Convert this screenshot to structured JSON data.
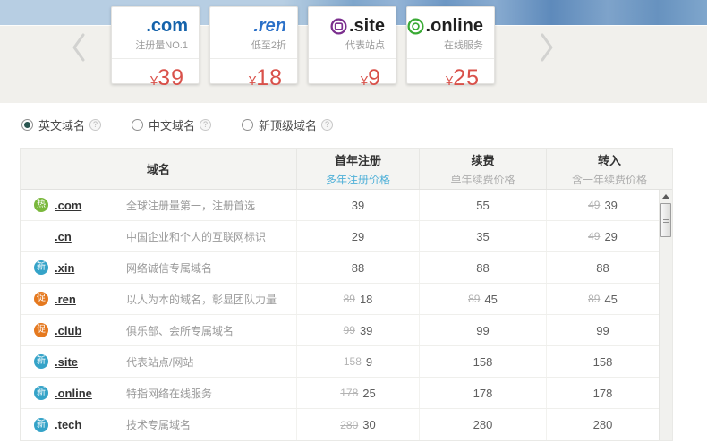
{
  "colors": {
    "accent_red": "#d9514a",
    "link_blue": "#4fb0d8",
    "com_blue": "#1563ab",
    "ren_blue": "#2a70c8",
    "badge_hot_green": "#7ab83c",
    "badge_new_blue": "#35a3c8",
    "badge_promo_orange": "#e5791f",
    "hero_band_blue": "#b7cee3"
  },
  "carousel": {
    "cards": [
      {
        "tld": ".com",
        "tagline": "注册量NO.1",
        "currency": "¥",
        "price": "39"
      },
      {
        "tld": ".ren",
        "tagline": "低至2折",
        "currency": "¥",
        "price": "18"
      },
      {
        "tld": ".site",
        "tagline": "代表站点",
        "currency": "¥",
        "price": "9"
      },
      {
        "tld": ".online",
        "tagline": "在线服务",
        "currency": "¥",
        "price": "25"
      }
    ]
  },
  "filters": {
    "help_icon": "?",
    "options": [
      {
        "label": "英文域名",
        "selected": true
      },
      {
        "label": "中文域名",
        "selected": false
      },
      {
        "label": "新顶级域名",
        "selected": false
      }
    ]
  },
  "table": {
    "headers": {
      "domain": "域名",
      "first_year": "首年注册",
      "first_year_sub": "多年注册价格",
      "renew": "续费",
      "renew_sub": "单年续费价格",
      "transfer": "转入",
      "transfer_sub": "含一年续费价格"
    },
    "rows": [
      {
        "badge": "热",
        "tld": ".com",
        "desc": "全球注册量第一，注册首选",
        "first_old": "",
        "first": "39",
        "renew_old": "",
        "renew": "55",
        "transfer_old": "49",
        "transfer": "39"
      },
      {
        "badge": "",
        "tld": ".cn",
        "desc": "中国企业和个人的互联网标识",
        "first_old": "",
        "first": "29",
        "renew_old": "",
        "renew": "35",
        "transfer_old": "49",
        "transfer": "29"
      },
      {
        "badge": "新",
        "tld": ".xin",
        "desc": "网络诚信专属域名",
        "first_old": "",
        "first": "88",
        "renew_old": "",
        "renew": "88",
        "transfer_old": "",
        "transfer": "88"
      },
      {
        "badge": "促",
        "tld": ".ren",
        "desc": "以人为本的域名，彰显团队力量",
        "first_old": "89",
        "first": "18",
        "renew_old": "89",
        "renew": "45",
        "transfer_old": "89",
        "transfer": "45"
      },
      {
        "badge": "促",
        "tld": ".club",
        "desc": "俱乐部、会所专属域名",
        "first_old": "99",
        "first": "39",
        "renew_old": "",
        "renew": "99",
        "transfer_old": "",
        "transfer": "99"
      },
      {
        "badge": "新",
        "tld": ".site",
        "desc": "代表站点/网站",
        "first_old": "158",
        "first": "9",
        "renew_old": "",
        "renew": "158",
        "transfer_old": "",
        "transfer": "158"
      },
      {
        "badge": "新",
        "tld": ".online",
        "desc": "特指网络在线服务",
        "first_old": "178",
        "first": "25",
        "renew_old": "",
        "renew": "178",
        "transfer_old": "",
        "transfer": "178"
      },
      {
        "badge": "新",
        "tld": ".tech",
        "desc": "技术专属域名",
        "first_old": "280",
        "first": "30",
        "renew_old": "",
        "renew": "280",
        "transfer_old": "",
        "transfer": "280"
      }
    ]
  }
}
